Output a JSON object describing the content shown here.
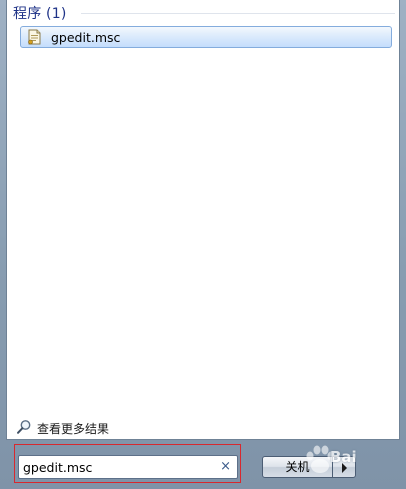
{
  "results": {
    "section_title": "程序 (1)",
    "items": [
      {
        "label": "gpedit.msc",
        "icon": "msc-document-icon",
        "selected": true
      }
    ],
    "more_results_label": "查看更多结果"
  },
  "search": {
    "value": "gpedit.msc",
    "clear_icon": "×"
  },
  "power": {
    "shutdown_label": "关机"
  },
  "watermark": {
    "text": "Bai"
  },
  "colors": {
    "section_title": "#1e3287",
    "selection_border": "#84acdd",
    "highlight_border": "#d8282e"
  }
}
